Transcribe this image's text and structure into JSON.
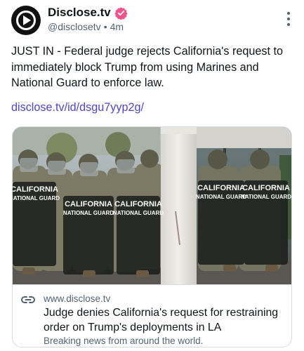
{
  "author": {
    "name": "Disclose.tv",
    "handle": "@disclosetv",
    "separator": "•",
    "time": "4m",
    "verified": true,
    "verified_color": "#f0528a"
  },
  "post": {
    "text": "JUST IN - Federal judge rejects California's request to immediately block Trump from using Marines and National Guard to enforce law.",
    "link_text": "disclose.tv/id/dsgu7yyp2g/",
    "link_color": "#5046c8"
  },
  "card": {
    "domain": "www.disclose.tv",
    "title": "Judge denies California's request for restraining order on Trump's deployments in LA",
    "description": "Breaking news from around the world.",
    "image": {
      "shield_text_line1": "CALIFORNIA",
      "shield_text_line2": "NATIONAL GUARD"
    }
  },
  "icons": {
    "avatar": "play-logo-icon",
    "verified": "verified-badge-icon",
    "more": "more-vertical-icon",
    "link": "link-icon"
  }
}
